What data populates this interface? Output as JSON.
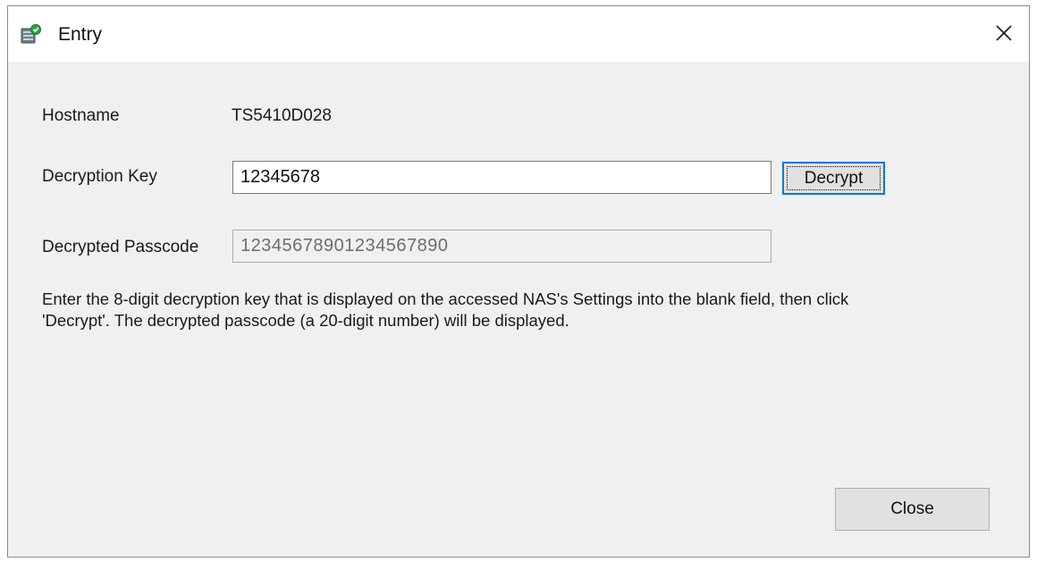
{
  "window": {
    "title": "Entry",
    "icon": "nas-app-icon",
    "close_icon": "close-icon"
  },
  "form": {
    "hostname": {
      "label": "Hostname",
      "value": "TS5410D028"
    },
    "decryption_key": {
      "label": "Decryption Key",
      "value": "12345678"
    },
    "decrypted_passcode": {
      "label": "Decrypted Passcode",
      "value": "12345678901234567890"
    },
    "decrypt_button": "Decrypt",
    "instructions_line1": "Enter the 8-digit decryption key that is displayed on the accessed NAS's Settings into the blank field, then click",
    "instructions_line2": "'Decrypt'. The decrypted passcode (a 20-digit number) will be displayed."
  },
  "footer": {
    "close_button": "Close"
  },
  "colors": {
    "accent": "#0078d7",
    "window_bg": "#f0f0f0",
    "titlebar_bg": "#ffffff"
  }
}
